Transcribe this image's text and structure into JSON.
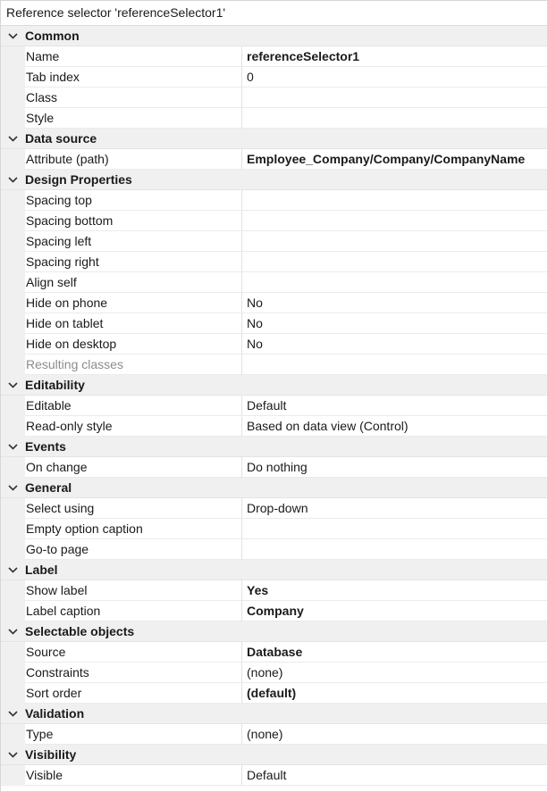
{
  "title": "Reference selector 'referenceSelector1'",
  "categories": [
    {
      "label": "Common",
      "props": [
        {
          "name": "Name",
          "value": "referenceSelector1",
          "bold": true
        },
        {
          "name": "Tab index",
          "value": "0",
          "bold": false
        },
        {
          "name": "Class",
          "value": "",
          "bold": false
        },
        {
          "name": "Style",
          "value": "",
          "bold": false
        }
      ]
    },
    {
      "label": "Data source",
      "props": [
        {
          "name": "Attribute (path)",
          "value": "Employee_Company/Company/CompanyName",
          "bold": true
        }
      ]
    },
    {
      "label": "Design Properties",
      "props": [
        {
          "name": "Spacing top",
          "value": "",
          "bold": false
        },
        {
          "name": "Spacing bottom",
          "value": "",
          "bold": false
        },
        {
          "name": "Spacing left",
          "value": "",
          "bold": false
        },
        {
          "name": "Spacing right",
          "value": "",
          "bold": false
        },
        {
          "name": "Align self",
          "value": "",
          "bold": false
        },
        {
          "name": "Hide on phone",
          "value": "No",
          "bold": false
        },
        {
          "name": "Hide on tablet",
          "value": "No",
          "bold": false
        },
        {
          "name": "Hide on desktop",
          "value": "No",
          "bold": false
        },
        {
          "name": "Resulting classes",
          "value": "",
          "bold": false,
          "disabled": true
        }
      ]
    },
    {
      "label": "Editability",
      "props": [
        {
          "name": "Editable",
          "value": "Default",
          "bold": false
        },
        {
          "name": "Read-only style",
          "value": "Based on data view (Control)",
          "bold": false
        }
      ]
    },
    {
      "label": "Events",
      "props": [
        {
          "name": "On change",
          "value": "Do nothing",
          "bold": false
        }
      ]
    },
    {
      "label": "General",
      "props": [
        {
          "name": "Select using",
          "value": "Drop-down",
          "bold": false
        },
        {
          "name": "Empty option caption",
          "value": "",
          "bold": false
        },
        {
          "name": "Go-to page",
          "value": "",
          "bold": false
        }
      ]
    },
    {
      "label": "Label",
      "props": [
        {
          "name": "Show label",
          "value": "Yes",
          "bold": true
        },
        {
          "name": "Label caption",
          "value": "Company",
          "bold": true
        }
      ]
    },
    {
      "label": "Selectable objects",
      "props": [
        {
          "name": "Source",
          "value": "Database",
          "bold": true
        },
        {
          "name": "Constraints",
          "value": "(none)",
          "bold": false
        },
        {
          "name": "Sort order",
          "value": "(default)",
          "bold": true
        }
      ]
    },
    {
      "label": "Validation",
      "props": [
        {
          "name": "Type",
          "value": "(none)",
          "bold": false
        }
      ]
    },
    {
      "label": "Visibility",
      "props": [
        {
          "name": "Visible",
          "value": "Default",
          "bold": false
        }
      ]
    }
  ]
}
